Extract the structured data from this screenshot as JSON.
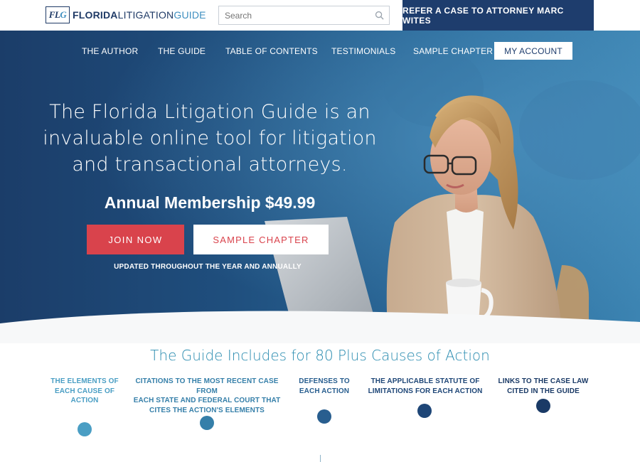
{
  "header": {
    "logo_mark": "FLG",
    "logo_word_bold": "FLORIDA",
    "logo_word_mid": "LITIGATION",
    "logo_word_light": "GUIDE",
    "search_placeholder": "Search",
    "refer_button": "REFER A CASE TO ATTORNEY MARC WITES"
  },
  "nav": {
    "items": [
      "THE AUTHOR",
      "THE GUIDE",
      "TABLE OF CONTENTS",
      "TESTIMONIALS",
      "SAMPLE CHAPTER"
    ],
    "account": "MY ACCOUNT"
  },
  "hero": {
    "headline_lines": [
      "The Florida Litigation Guide is an",
      "invaluable online tool for litigation",
      "and transactional attorneys."
    ],
    "membership": "Annual Membership $49.99",
    "join_button": "JOIN NOW",
    "sample_button": "SAMPLE CHAPTER",
    "updated_note": "UPDATED THROUGHOUT THE YEAR AND ANNUALLY"
  },
  "includes": {
    "title": "The Guide Includes for 80 Plus Causes of Action",
    "features": [
      {
        "lines": [
          "THE ELEMENTS OF",
          "EACH CAUSE OF",
          "ACTION"
        ],
        "color": "#4a9ec4"
      },
      {
        "lines": [
          "CITATIONS TO THE MOST RECENT CASE FROM",
          "EACH STATE AND FEDERAL COURT THAT",
          "CITES THE ACTION'S ELEMENTS"
        ],
        "color": "#357fa9"
      },
      {
        "lines": [
          "DEFENSES TO",
          "EACH ACTION"
        ],
        "color": "#285e8f"
      },
      {
        "lines": [
          "THE APPLICABLE STATUTE OF",
          "LIMITATIONS FOR EACH ACTION"
        ],
        "color": "#1e4677"
      },
      {
        "lines": [
          "LINKS TO THE CASE LAW",
          "CITED IN THE GUIDE"
        ],
        "color": "#1a3a66"
      }
    ]
  },
  "colors": {
    "navy": "#1e3d6d",
    "accent_red": "#d9434c",
    "accent_teal": "#2a8cb0"
  }
}
